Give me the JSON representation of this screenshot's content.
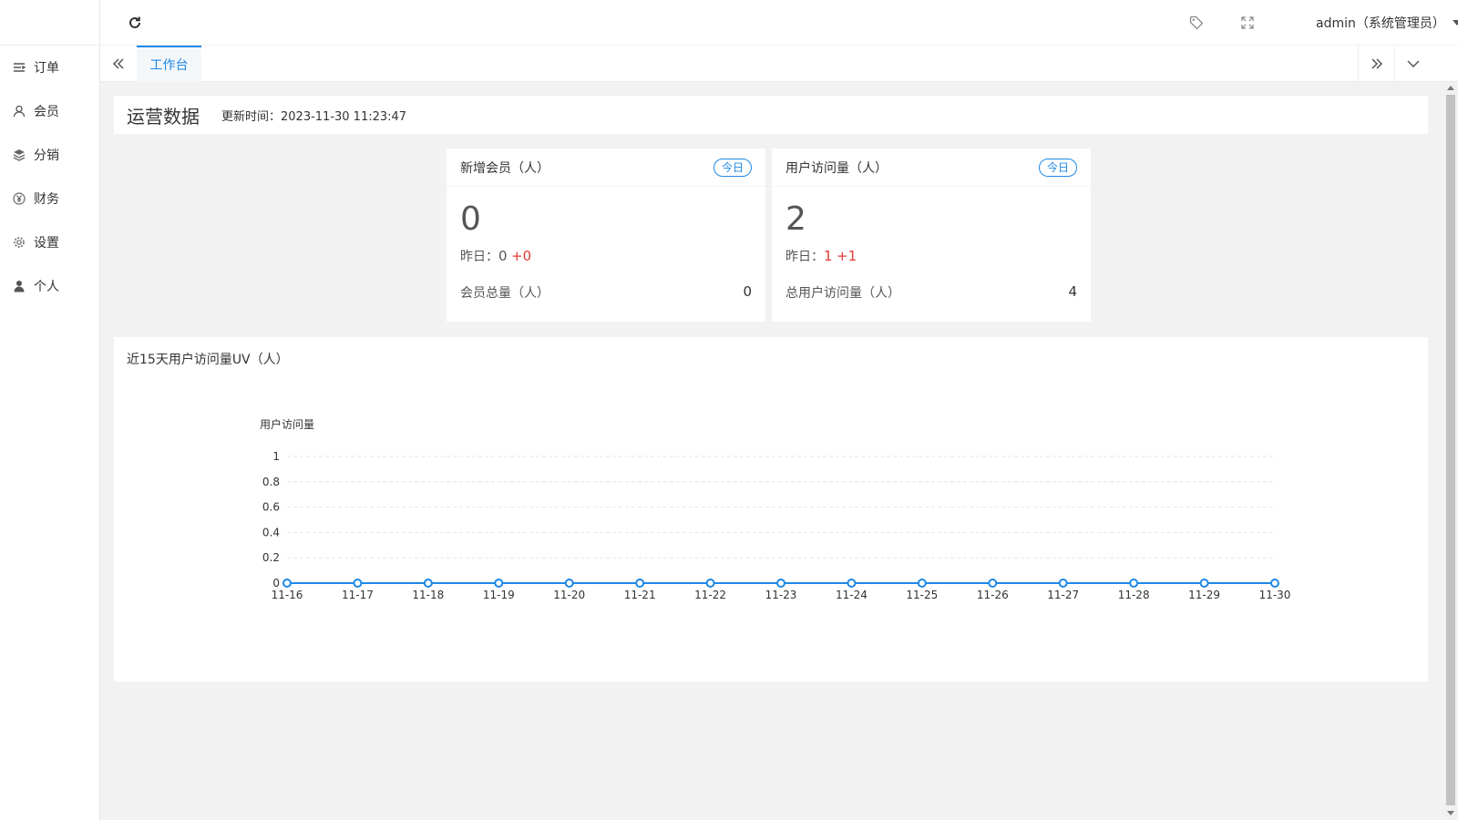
{
  "sidebar": {
    "items": [
      {
        "label": "订单",
        "icon": "list-icon"
      },
      {
        "label": "会员",
        "icon": "user-icon"
      },
      {
        "label": "分销",
        "icon": "layers-icon"
      },
      {
        "label": "财务",
        "icon": "yen-icon"
      },
      {
        "label": "设置",
        "icon": "gear-icon"
      },
      {
        "label": "个人",
        "icon": "person-icon"
      }
    ]
  },
  "header": {
    "user_label": "admin（系统管理员）"
  },
  "tabs": {
    "active_label": "工作台"
  },
  "ops": {
    "title": "运营数据",
    "update_time": "更新时间：2023-11-30 11:23:47"
  },
  "cards": [
    {
      "title": "新增会员（人）",
      "badge": "今日",
      "value": "0",
      "yesterday_label": "昨日：",
      "yesterday_value": "0",
      "delta": "+0",
      "total_label": "会员总量（人）",
      "total_value": "0"
    },
    {
      "title": "用户访问量（人）",
      "badge": "今日",
      "value": "2",
      "yesterday_label": "昨日：",
      "yesterday_value": "1",
      "delta": "+1",
      "total_label": "总用户访问量（人）",
      "total_value": "4"
    }
  ],
  "chart_section": {
    "title": "近15天用户访问量UV（人）"
  },
  "chart_data": {
    "type": "line",
    "title": "",
    "ylabel": "用户访问量",
    "xlabel": "",
    "categories": [
      "11-16",
      "11-17",
      "11-18",
      "11-19",
      "11-20",
      "11-21",
      "11-22",
      "11-23",
      "11-24",
      "11-25",
      "11-26",
      "11-27",
      "11-28",
      "11-29",
      "11-30"
    ],
    "values": [
      0,
      0,
      0,
      0,
      0,
      0,
      0,
      0,
      0,
      0,
      0,
      0,
      0,
      0,
      0
    ],
    "ylim": [
      0,
      1
    ],
    "yticks": [
      "0",
      "0.2",
      "0.4",
      "0.6",
      "0.8",
      "1"
    ],
    "grid": true,
    "color": "#1e88e5"
  },
  "colors": {
    "accent": "#1e88e5",
    "increase": "#e53935"
  }
}
